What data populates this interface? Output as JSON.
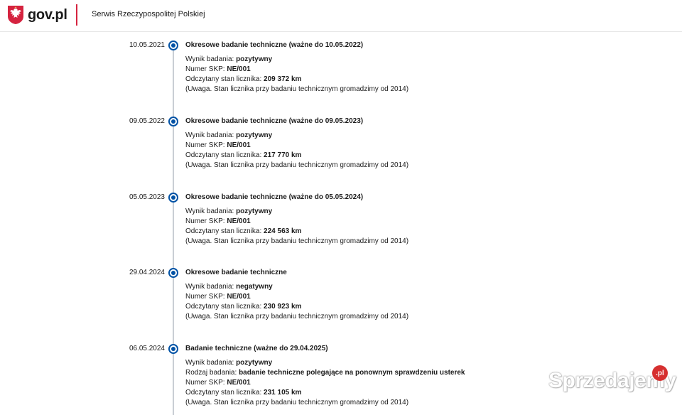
{
  "header": {
    "logo_text": "gov.pl",
    "service_name": "Serwis Rzeczypospolitej Polskiej"
  },
  "colors": {
    "accent": "#0052a5",
    "divider": "#d5233f",
    "timeline": "#c9ced4"
  },
  "entries": [
    {
      "date": "10.05.2021",
      "title": "Okresowe badanie techniczne (ważne do 10.05.2022)",
      "lines": [
        {
          "label": "Wynik badania: ",
          "value": "pozytywny"
        },
        {
          "label": "Numer SKP: ",
          "value": "NE/001"
        },
        {
          "label": "Odczytany stan licznika: ",
          "value": "209 372 km"
        },
        {
          "label": "(Uwaga. Stan licznika przy badaniu technicznym gromadzimy od 2014)",
          "value": ""
        }
      ]
    },
    {
      "date": "09.05.2022",
      "title": "Okresowe badanie techniczne (ważne do 09.05.2023)",
      "lines": [
        {
          "label": "Wynik badania: ",
          "value": "pozytywny"
        },
        {
          "label": "Numer SKP: ",
          "value": "NE/001"
        },
        {
          "label": "Odczytany stan licznika: ",
          "value": "217 770 km"
        },
        {
          "label": "(Uwaga. Stan licznika przy badaniu technicznym gromadzimy od 2014)",
          "value": ""
        }
      ]
    },
    {
      "date": "05.05.2023",
      "title": "Okresowe badanie techniczne (ważne do 05.05.2024)",
      "lines": [
        {
          "label": "Wynik badania: ",
          "value": "pozytywny"
        },
        {
          "label": "Numer SKP: ",
          "value": "NE/001"
        },
        {
          "label": "Odczytany stan licznika: ",
          "value": "224 563 km"
        },
        {
          "label": "(Uwaga. Stan licznika przy badaniu technicznym gromadzimy od 2014)",
          "value": ""
        }
      ]
    },
    {
      "date": "29.04.2024",
      "title": "Okresowe badanie techniczne",
      "lines": [
        {
          "label": "Wynik badania: ",
          "value": "negatywny"
        },
        {
          "label": "Numer SKP: ",
          "value": "NE/001"
        },
        {
          "label": "Odczytany stan licznika: ",
          "value": "230 923 km"
        },
        {
          "label": "(Uwaga. Stan licznika przy badaniu technicznym gromadzimy od 2014)",
          "value": ""
        }
      ]
    },
    {
      "date": "06.05.2024",
      "title": "Badanie techniczne (ważne do 29.04.2025)",
      "lines": [
        {
          "label": "Wynik badania: ",
          "value": "pozytywny"
        },
        {
          "label": "Rodzaj badania: ",
          "value": "badanie techniczne polegające na ponownym sprawdzeniu usterek"
        },
        {
          "label": "Numer SKP: ",
          "value": "NE/001"
        },
        {
          "label": "Odczytany stan licznika: ",
          "value": "231 105 km"
        },
        {
          "label": "(Uwaga. Stan licznika przy badaniu technicznym gromadzimy od 2014)",
          "value": ""
        }
      ]
    }
  ],
  "watermark": {
    "text": "Sprzedajemy",
    "badge": ".pl"
  }
}
